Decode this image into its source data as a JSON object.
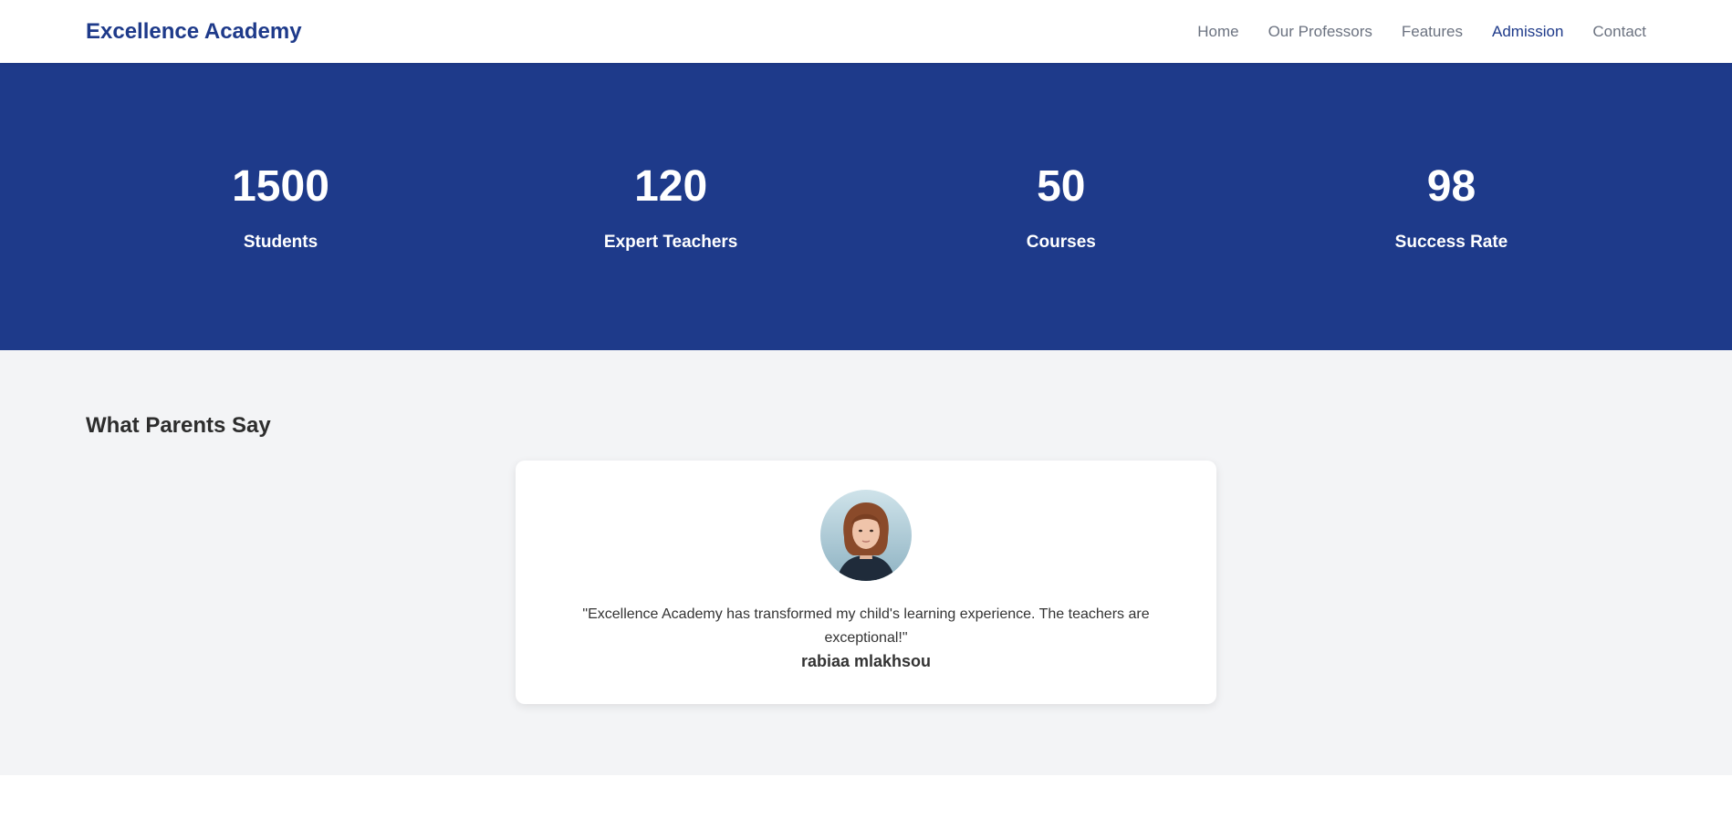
{
  "nav": {
    "brand": "Excellence Academy",
    "links": [
      "Home",
      "Our Professors",
      "Features",
      "Admission",
      "Contact"
    ],
    "active_link": "Admission"
  },
  "stats": [
    {
      "value": "1500",
      "label": "Students"
    },
    {
      "value": "120",
      "label": "Expert Teachers"
    },
    {
      "value": "50",
      "label": "Courses"
    },
    {
      "value": "98",
      "label": "Success Rate"
    }
  ],
  "testimonials": {
    "title": "What Parents Say",
    "items": [
      {
        "quote": "\"Excellence Academy has transformed my child's learning experience. The teachers are exceptional!\"",
        "author": "rabiaa mlakhsou"
      }
    ]
  },
  "colors": {
    "brand": "#1e3a8a",
    "nav_text": "#6b7280",
    "section_bg": "#f3f4f6"
  }
}
